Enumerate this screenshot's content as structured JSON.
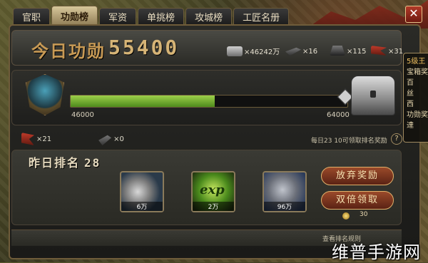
{
  "tabs": [
    "官职",
    "功勋榜",
    "军资",
    "单挑榜",
    "攻城榜",
    "工匠名册"
  ],
  "active_tab_index": 1,
  "close_glyph": "✕",
  "header": {
    "today_label": "今日功勋",
    "today_value": "55400"
  },
  "resources": [
    {
      "icon": "silver-ingot-icon",
      "value": "×46242万"
    },
    {
      "icon": "cannon-icon",
      "value": "×16"
    },
    {
      "icon": "soldier-icon",
      "value": "×115"
    },
    {
      "icon": "flag-icon",
      "value": "×31"
    }
  ],
  "progress": {
    "min_label": "46000",
    "max_label": "64000",
    "fraction": 0.52
  },
  "tooltip_lines": [
    "5级王",
    "宝箱奖",
    "百",
    "丝",
    "西",
    "功勋奖",
    "達"
  ],
  "items": [
    {
      "icon": "flag-item-icon",
      "value": "×21"
    },
    {
      "icon": "cannon-item-icon",
      "value": "×0"
    }
  ],
  "hint": "每日23 10可领取排名奖励",
  "info_glyph": "?",
  "rank": {
    "label": "昨日排名",
    "value": "28"
  },
  "rewards": [
    {
      "icon": "silver-coins-icon",
      "caption": "6万"
    },
    {
      "icon": "exp-icon",
      "caption": "2万",
      "text": "exp"
    },
    {
      "icon": "ore-icon",
      "caption": "96万"
    }
  ],
  "buttons": {
    "give_up": "放弃奖励",
    "double": "双倍领取"
  },
  "coin_count": "30",
  "view_rules": "查看排名规则",
  "watermark": "维普手游网",
  "colors": {
    "accent": "#c89a55",
    "progress": "#7ab832",
    "button": "#8a3a1e"
  }
}
